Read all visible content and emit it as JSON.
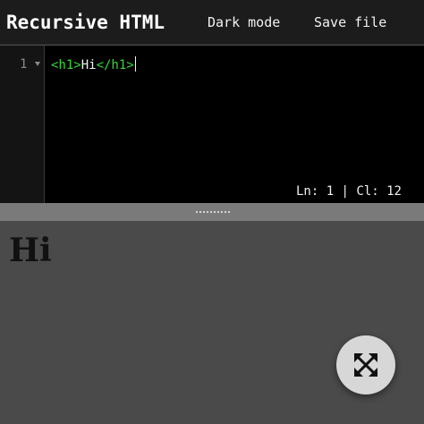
{
  "header": {
    "title": "Recursive HTML",
    "dark_mode_label": "Dark mode",
    "save_file_label": "Save file"
  },
  "editor": {
    "line_numbers": [
      "1"
    ],
    "code": {
      "open_tag": "<h1>",
      "text": "Hi",
      "close_tag": "</h1>"
    },
    "status": "Ln: 1 | Cl: 12",
    "tag_color": "#35d73a"
  },
  "preview": {
    "heading": "Hi"
  },
  "fab": {
    "icon": "expand-arrows-icon"
  }
}
